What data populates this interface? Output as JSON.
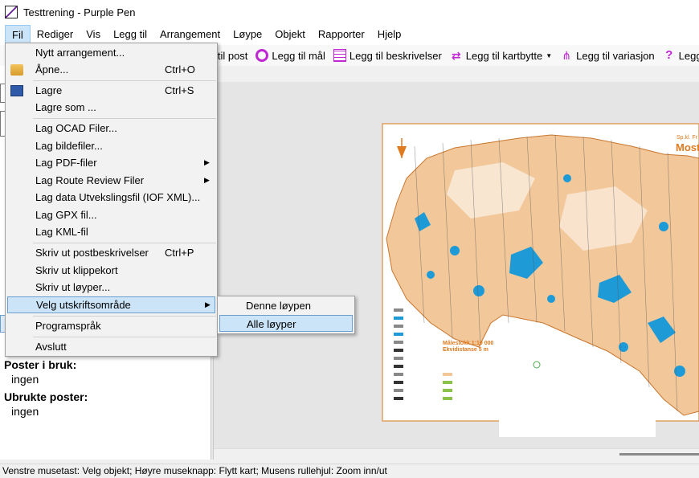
{
  "window": {
    "title": "Testtrening - Purple Pen"
  },
  "menubar": [
    "Fil",
    "Rediger",
    "Vis",
    "Legg til",
    "Arrangement",
    "Løype",
    "Objekt",
    "Rapporter",
    "Hjelp"
  ],
  "toolbar": {
    "items": [
      {
        "label": "g til post",
        "icon": "control-icon"
      },
      {
        "label": "Legg til mål",
        "icon": "finish-icon"
      },
      {
        "label": "Legg til beskrivelser",
        "icon": "description-grid-icon"
      },
      {
        "label": "Legg til kartbytte",
        "icon": "map-exchange-icon"
      },
      {
        "label": "Legg til variasjon",
        "icon": "variation-icon"
      },
      {
        "label": "Legg til s",
        "icon": "help-question-icon"
      }
    ]
  },
  "file_menu": {
    "items": [
      {
        "label": "Nytt arrangement...",
        "shortcut": "",
        "submenu": false,
        "icon": ""
      },
      {
        "label": "Åpne...",
        "shortcut": "Ctrl+O",
        "submenu": false,
        "icon": "folder-icon"
      },
      {
        "label": "Lagre",
        "shortcut": "Ctrl+S",
        "submenu": false,
        "icon": "floppy-icon"
      },
      {
        "label": "Lagre som ...",
        "shortcut": "",
        "submenu": false,
        "icon": ""
      },
      {
        "label": "Lag OCAD Filer...",
        "shortcut": "",
        "submenu": false,
        "icon": ""
      },
      {
        "label": "Lag bildefiler...",
        "shortcut": "",
        "submenu": false,
        "icon": ""
      },
      {
        "label": "Lag PDF-filer",
        "shortcut": "",
        "submenu": true,
        "icon": ""
      },
      {
        "label": "Lag Route Review Filer",
        "shortcut": "",
        "submenu": true,
        "icon": ""
      },
      {
        "label": "Lag data Utvekslingsfil (IOF XML)...",
        "shortcut": "",
        "submenu": false,
        "icon": ""
      },
      {
        "label": "Lag GPX fil...",
        "shortcut": "",
        "submenu": false,
        "icon": ""
      },
      {
        "label": "Lag KML-fil",
        "shortcut": "",
        "submenu": false,
        "icon": ""
      },
      {
        "label": "Skriv ut postbeskrivelser",
        "shortcut": "Ctrl+P",
        "submenu": false,
        "icon": ""
      },
      {
        "label": "Skriv ut klippekort",
        "shortcut": "",
        "submenu": false,
        "icon": ""
      },
      {
        "label": "Skriv ut løyper...",
        "shortcut": "",
        "submenu": false,
        "icon": ""
      },
      {
        "label": "Velg utskriftsområde",
        "shortcut": "",
        "submenu": true,
        "icon": ""
      },
      {
        "label": "Programspråk",
        "shortcut": "",
        "submenu": false,
        "icon": ""
      },
      {
        "label": "Avslutt",
        "shortcut": "",
        "submenu": false,
        "icon": ""
      }
    ]
  },
  "submenu": {
    "items": [
      "Denne løypen",
      "Alle løyper"
    ]
  },
  "left_panel": {
    "poster_i_bruk_label": "Poster i bruk:",
    "poster_i_bruk_value": "ingen",
    "ubrukte_poster_label": "Ubrukte poster:",
    "ubrukte_poster_value": "ingen"
  },
  "map": {
    "title_text": "Most",
    "subtitle_text": "Sp.kl. Fr",
    "scale_text": "Målestokk 1:10 000",
    "equidistance_text": "Ekvidistanse 5 m"
  },
  "status_bar": {
    "text": "Venstre musetast: Velg objekt; Høyre museknapp: Flytt kart; Musens rullehjul: Zoom inn/ut"
  },
  "colors": {
    "accent": "#c026d3",
    "highlight": "#cce4f7",
    "map_orange": "#e07a1f",
    "water": "#1e9bd7"
  }
}
